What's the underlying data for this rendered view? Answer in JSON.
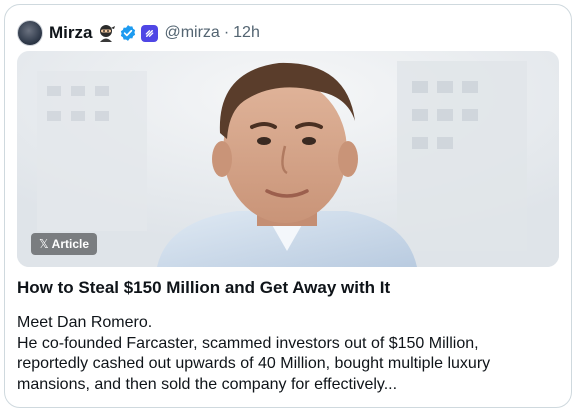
{
  "post": {
    "author": {
      "display_name": "Mirza",
      "handle": "@mirza",
      "separator": "·",
      "time": "12h",
      "avatar_icon": "avatar-photo",
      "emoji_icon": "ninja-emoji-icon",
      "verified_icon": "verified-badge-icon",
      "extra_icon": "farcaster-icon"
    },
    "media": {
      "badge_icon": "x-logo-icon",
      "badge_label": "Article"
    },
    "article": {
      "title": "How to Steal $150 Million and Get Away with It",
      "lines": [
        "Meet Dan Romero.",
        "He co-founded Farcaster, scammed investors out of $150 Million,",
        "reportedly cashed out upwards of 40 Million, bought multiple luxury",
        "mansions, and then sold the company for effectively..."
      ]
    }
  },
  "colors": {
    "border": "#cfd9de",
    "secondary_text": "#536471",
    "verified": "#1d9bf0",
    "farcaster": "#4f46e5"
  }
}
